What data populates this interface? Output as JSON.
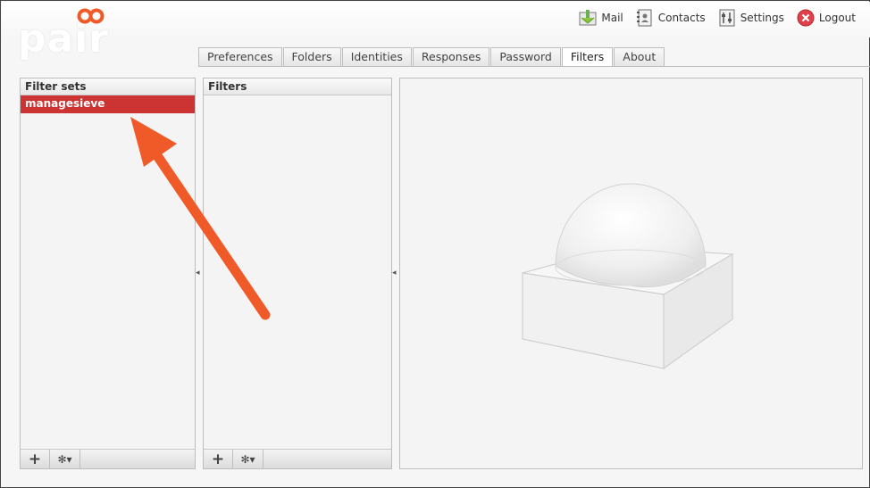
{
  "brand": {
    "logo_text": "pair",
    "accent": "#f05a28"
  },
  "topnav": [
    {
      "label": "Mail",
      "icon": "mail-icon"
    },
    {
      "label": "Contacts",
      "icon": "contacts-icon"
    },
    {
      "label": "Settings",
      "icon": "settings-icon"
    },
    {
      "label": "Logout",
      "icon": "logout-icon"
    }
  ],
  "tabs": [
    {
      "label": "Preferences"
    },
    {
      "label": "Folders"
    },
    {
      "label": "Identities"
    },
    {
      "label": "Responses"
    },
    {
      "label": "Password"
    },
    {
      "label": "Filters",
      "active": true
    },
    {
      "label": "About"
    }
  ],
  "filter_sets": {
    "title": "Filter sets",
    "items": [
      "managesieve"
    ],
    "selected": "managesieve"
  },
  "filters": {
    "title": "Filters",
    "items": []
  },
  "footer": {
    "add_symbol": "+",
    "gear_symbol": "✻▾"
  },
  "colors": {
    "selection": "#cc3333",
    "arrow": "#f05a28"
  }
}
